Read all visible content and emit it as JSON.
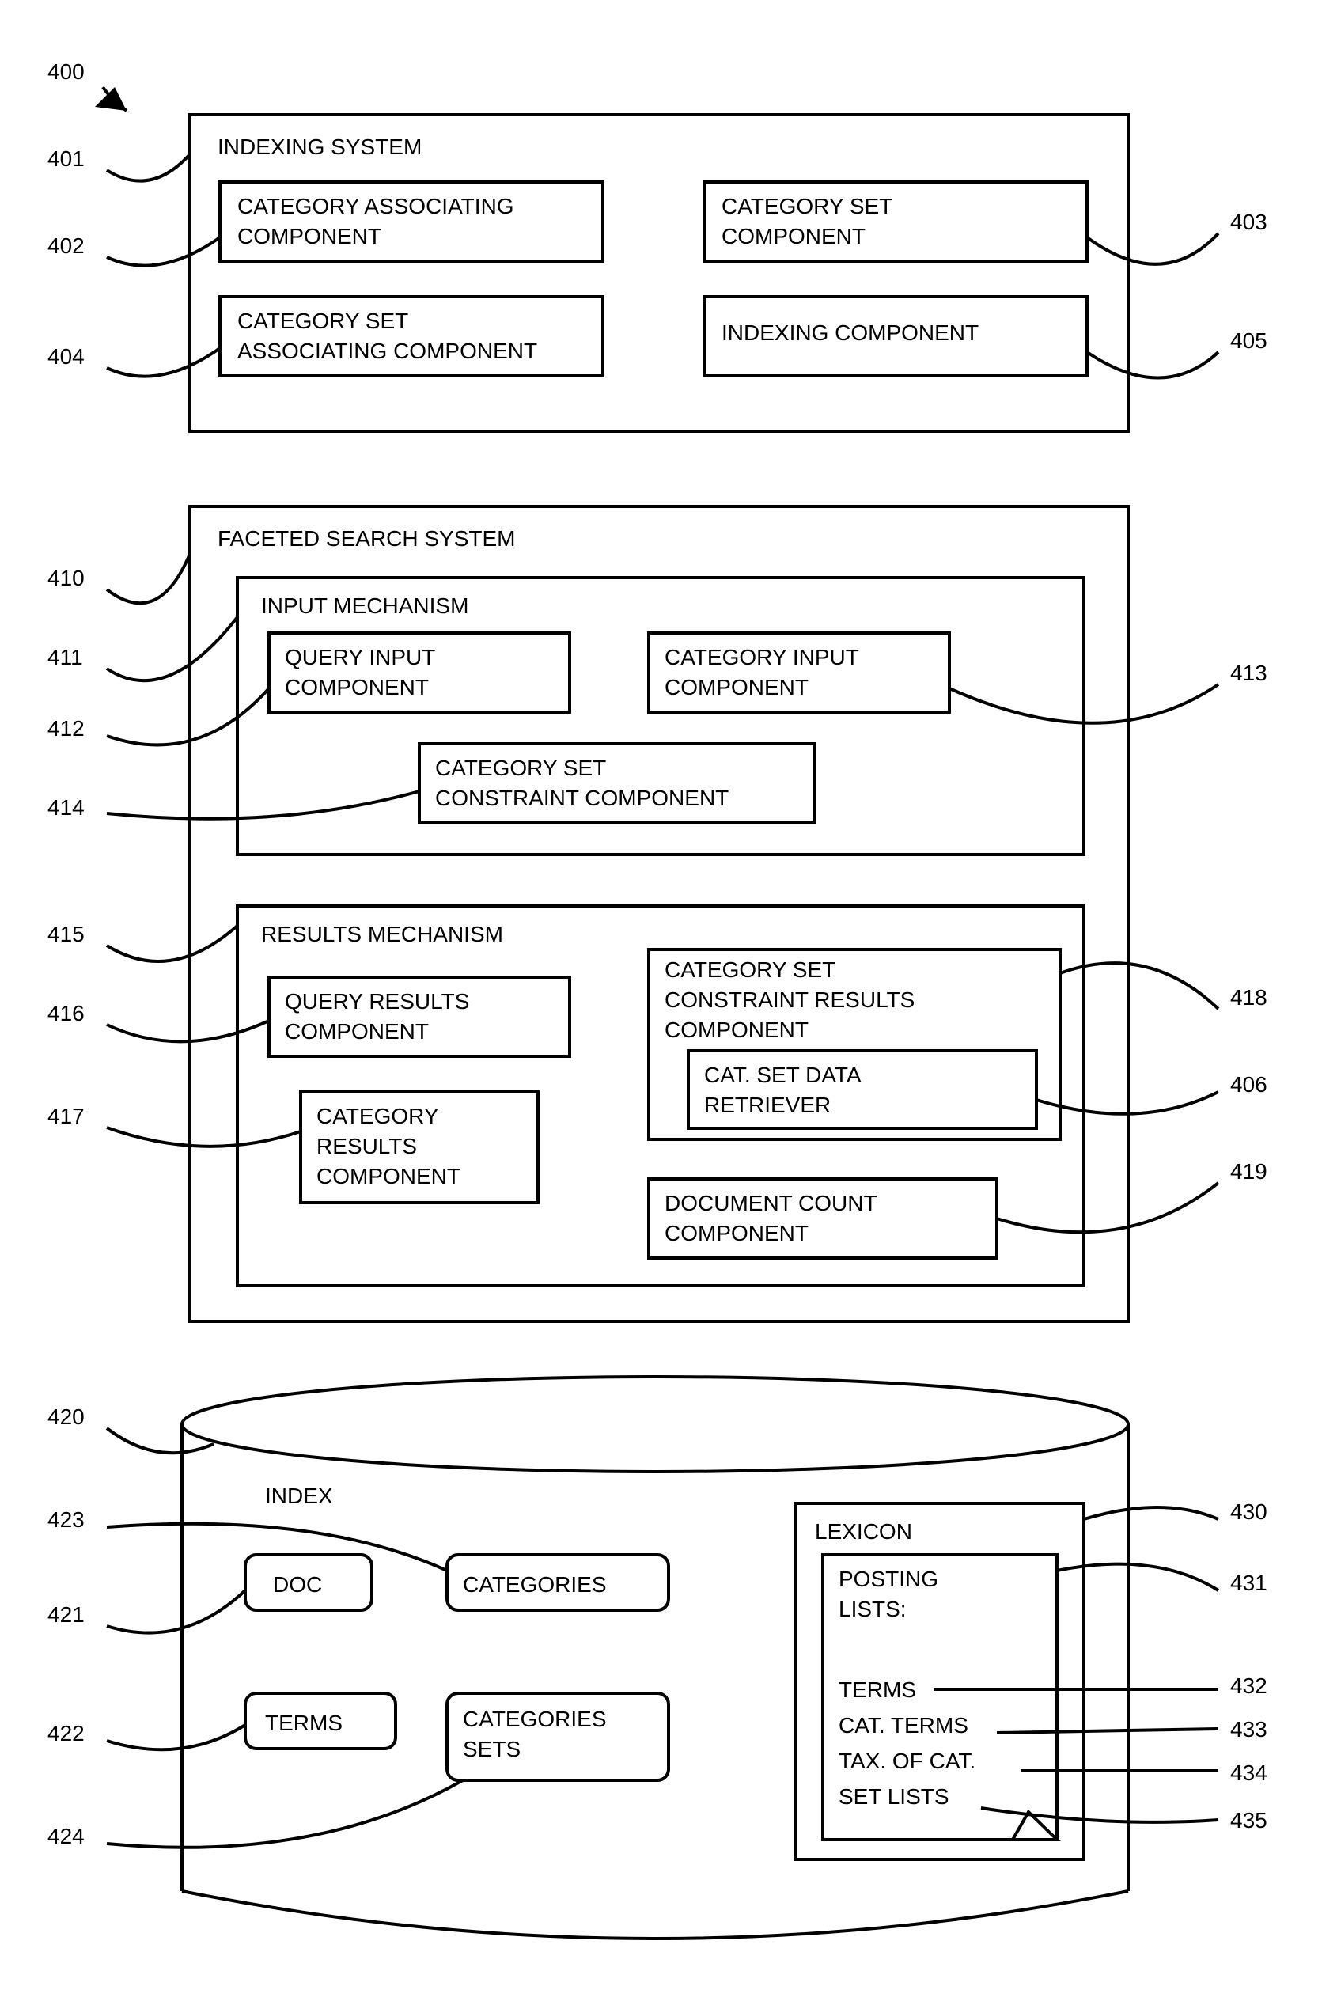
{
  "figure": {
    "label_400": "400",
    "label_401": "401",
    "label_402": "402",
    "label_403": "403",
    "label_404": "404",
    "label_405": "405",
    "label_406": "406",
    "label_410": "410",
    "label_411": "411",
    "label_412": "412",
    "label_413": "413",
    "label_414": "414",
    "label_415": "415",
    "label_416": "416",
    "label_417": "417",
    "label_418": "418",
    "label_419": "419",
    "label_420": "420",
    "label_421": "421",
    "label_422": "422",
    "label_423": "423",
    "label_424": "424",
    "label_430": "430",
    "label_431": "431",
    "label_432": "432",
    "label_433": "433",
    "label_434": "434",
    "label_435": "435",
    "indexing_system_title": "INDEXING SYSTEM",
    "cat_assoc_l1": "CATEGORY ASSOCIATING",
    "cat_assoc_l2": "COMPONENT",
    "cat_set_l1": "CATEGORY SET",
    "cat_set_l2": "COMPONENT",
    "cat_set_assoc_l1": "CATEGORY SET",
    "cat_set_assoc_l2": "ASSOCIATING COMPONENT",
    "indexing_component": "INDEXING COMPONENT",
    "faceted_search_title": "FACETED SEARCH SYSTEM",
    "input_mech_title": "INPUT MECHANISM",
    "query_input_l1": "QUERY INPUT",
    "query_input_l2": "COMPONENT",
    "category_input_l1": "CATEGORY INPUT",
    "category_input_l2": "COMPONENT",
    "cat_set_constraint_l1": "CATEGORY SET",
    "cat_set_constraint_l2": "CONSTRAINT COMPONENT",
    "results_mech_title": "RESULTS MECHANISM",
    "query_results_l1": "QUERY RESULTS",
    "query_results_l2": "COMPONENT",
    "category_results_l1": "CATEGORY",
    "category_results_l2": "RESULTS",
    "category_results_l3": "COMPONENT",
    "cat_set_cres_l1": "CATEGORY SET",
    "cat_set_cres_l2": "CONSTRAINT RESULTS",
    "cat_set_cres_l3": "COMPONENT",
    "cat_set_data_l1": "CAT. SET DATA",
    "cat_set_data_l2": "RETRIEVER",
    "doc_count_l1": "DOCUMENT COUNT",
    "doc_count_l2": "COMPONENT",
    "index_title": "INDEX",
    "doc_label": "DOC",
    "categories_label": "CATEGORIES",
    "terms_label": "TERMS",
    "cat_sets_l1": "CATEGORIES",
    "cat_sets_l2": "SETS",
    "lexicon_title": "LEXICON",
    "posting_lists_l1": "POSTING",
    "posting_lists_l2": "LISTS:",
    "lex_terms": "TERMS",
    "lex_cat_terms": "CAT. TERMS",
    "lex_tax_of_cat": "TAX. OF CAT.",
    "lex_set_lists": "SET LISTS"
  }
}
